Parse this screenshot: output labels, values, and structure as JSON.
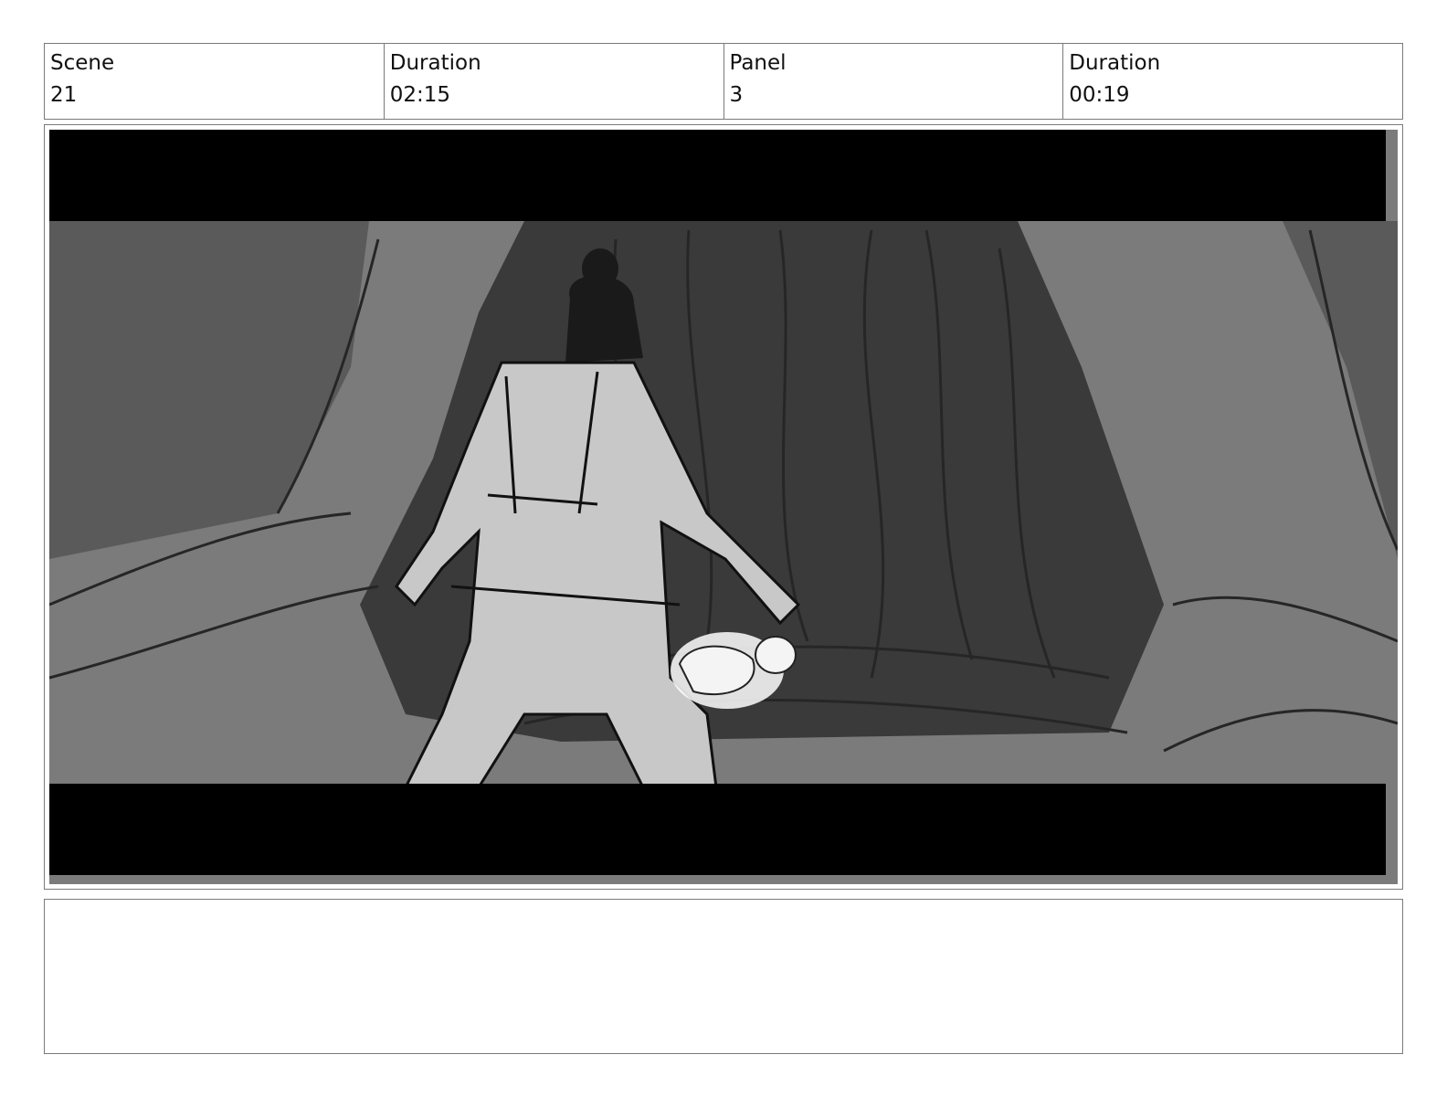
{
  "header": {
    "scene_label": "Scene",
    "scene_value": "21",
    "scene_duration_label": "Duration",
    "scene_duration_value": "02:15",
    "panel_label": "Panel",
    "panel_value": "3",
    "panel_duration_label": "Duration",
    "panel_duration_value": "00:19"
  },
  "notes": {
    "text": ""
  },
  "colors": {
    "border": "#7a7a7a",
    "letterbox": "#000000",
    "cave_light": "#7b7b7b",
    "cave_dark": "#3a3a3a",
    "figure": "#c8c8c8"
  }
}
